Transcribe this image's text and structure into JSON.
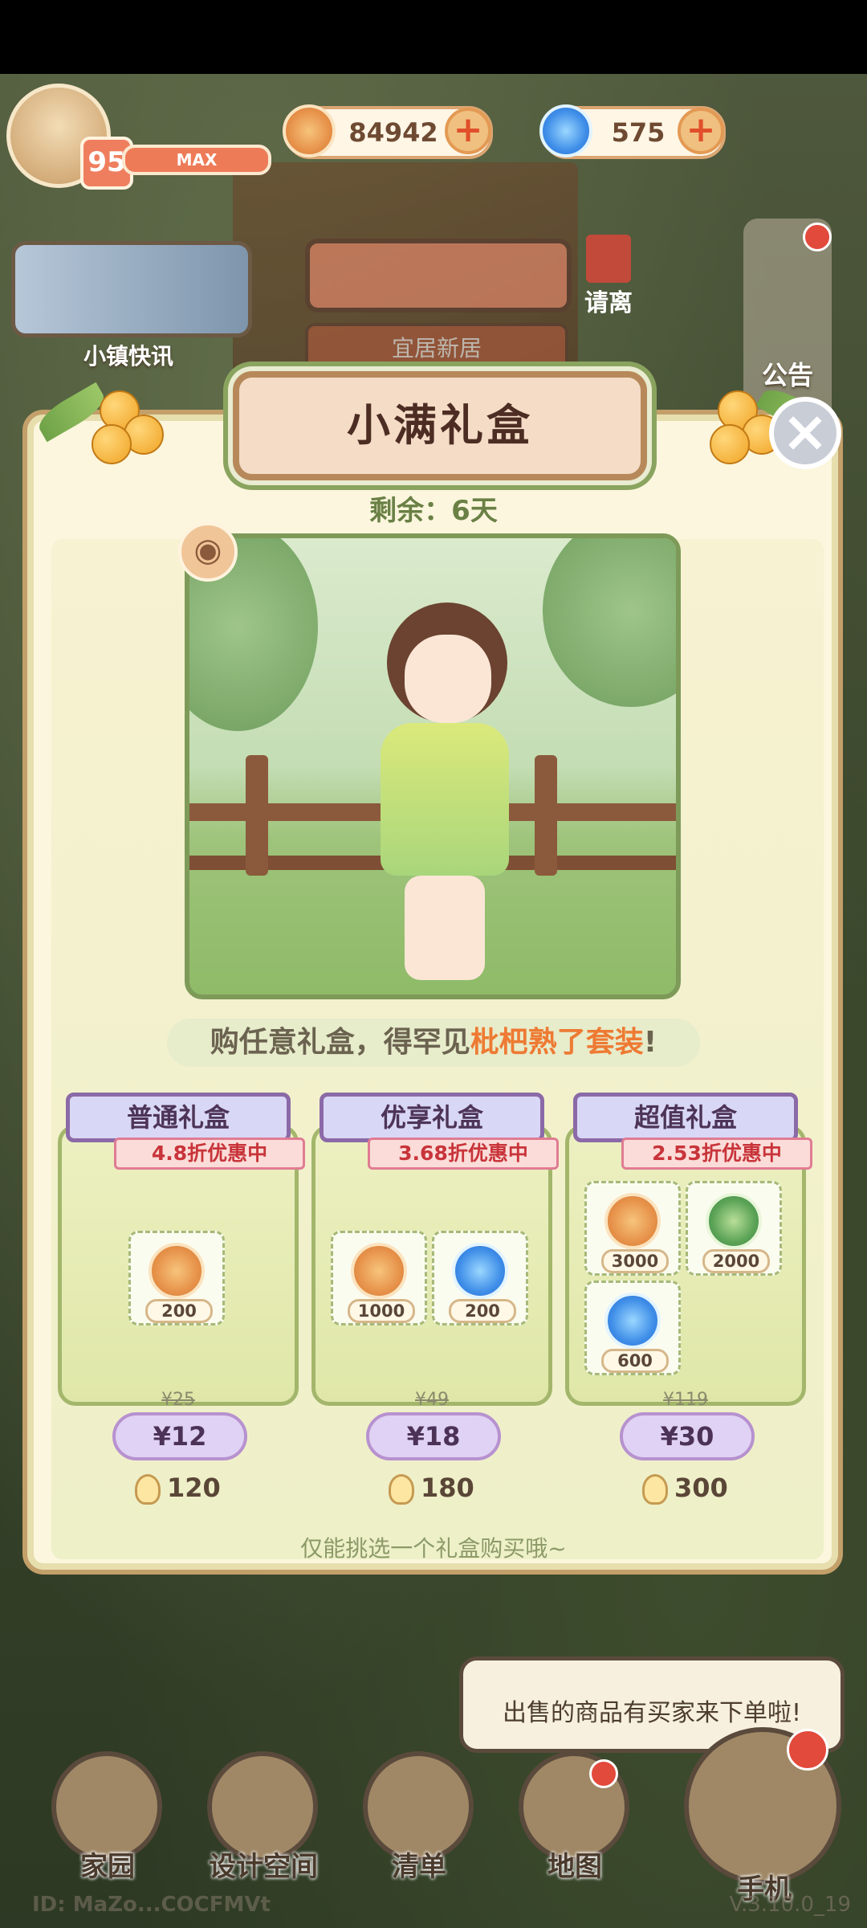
{
  "hud": {
    "level": "95",
    "xp_label": "MAX",
    "coins": "84942",
    "gems": "575",
    "plus": "+"
  },
  "scene": {
    "news_label": "小镇快讯",
    "leave_label": "请离",
    "notice_label": "公告",
    "banner_text": "宜居新居"
  },
  "popup": {
    "title": "小满礼盒",
    "remaining": "剩余：6天",
    "close": "×",
    "promo_prefix": "购任意礼盒，得罕见",
    "promo_highlight": "枇杷熟了套装",
    "promo_suffix": "!",
    "note": "仅能挑选一个礼盒购买哦~",
    "boxes": [
      {
        "name": "普通礼盒",
        "discount": "4.8折优惠中",
        "items": [
          {
            "icon": "coin-icon",
            "qty": "200"
          }
        ],
        "old_price": "¥25",
        "price": "¥12",
        "bulbs": "120"
      },
      {
        "name": "优享礼盒",
        "discount": "3.68折优惠中",
        "items": [
          {
            "icon": "coin-icon",
            "qty": "1000"
          },
          {
            "icon": "gem-icon",
            "qty": "200"
          }
        ],
        "old_price": "¥49",
        "price": "¥18",
        "bulbs": "180"
      },
      {
        "name": "超值礼盒",
        "discount": "2.53折优惠中",
        "items": [
          {
            "icon": "coin-icon",
            "qty": "3000"
          },
          {
            "icon": "leaf-icon",
            "qty": "2000"
          },
          {
            "icon": "gem-icon",
            "qty": "600"
          }
        ],
        "old_price": "¥119",
        "price": "¥30",
        "bulbs": "300"
      }
    ]
  },
  "bubble": {
    "text": "出售的商品有买家来下单啦!"
  },
  "nav": [
    {
      "label": "家园"
    },
    {
      "label": "设计空间"
    },
    {
      "label": "清单"
    },
    {
      "label": "地图"
    },
    {
      "label": "手机"
    }
  ],
  "footer": {
    "uid": "ID: MaZo...COCFMVt",
    "version": "V.3.10.0_19"
  },
  "colors": {
    "accent": "#ee7a33",
    "panel": "#fbf6dd",
    "title_text": "#4d2d23"
  }
}
